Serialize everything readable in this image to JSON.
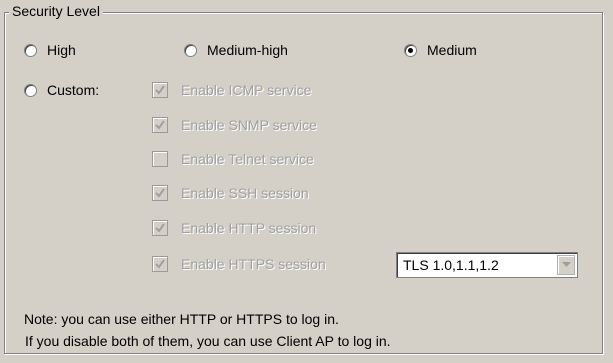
{
  "group": {
    "title": "Security Level"
  },
  "levels": [
    {
      "label": "High",
      "selected": false
    },
    {
      "label": "Medium-high",
      "selected": false
    },
    {
      "label": "Medium",
      "selected": true
    },
    {
      "label": "Custom:",
      "selected": false
    }
  ],
  "services": [
    {
      "label": "Enable ICMP service",
      "checked": true
    },
    {
      "label": "Enable SNMP service",
      "checked": true
    },
    {
      "label": "Enable Telnet service",
      "checked": false
    },
    {
      "label": "Enable SSH session",
      "checked": true
    },
    {
      "label": "Enable HTTP session",
      "checked": true
    },
    {
      "label": "Enable HTTPS session",
      "checked": true
    }
  ],
  "tls_select": {
    "value": "TLS 1.0,1.1,1.2"
  },
  "note": {
    "line1": "Note: you can use either HTTP or HTTPS to log in.",
    "line2": "If you disable both of them, you can use Client AP to log in."
  },
  "colors": {
    "disabled_text": "#a0a0a0",
    "background": "#d4d0c8"
  }
}
